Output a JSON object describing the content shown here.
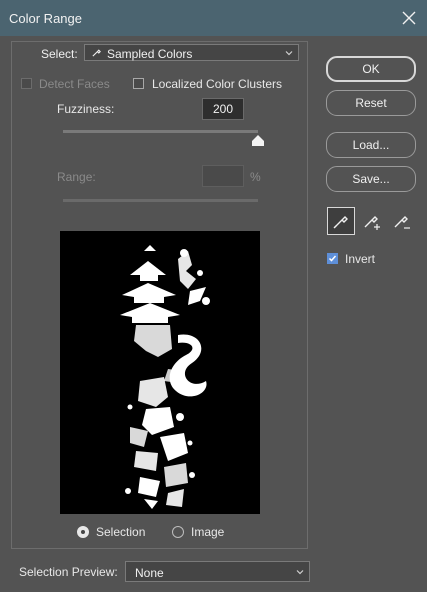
{
  "window": {
    "title": "Color Range"
  },
  "select": {
    "label": "Select:",
    "value": "Sampled Colors"
  },
  "options": {
    "detect_faces": "Detect Faces",
    "localized_color_clusters": "Localized Color Clusters"
  },
  "fuzziness": {
    "label": "Fuzziness:",
    "value": "200",
    "level": 1.0
  },
  "range": {
    "label": "Range:",
    "value": "",
    "unit": "%"
  },
  "view": {
    "selection": "Selection",
    "image": "Image",
    "selected": "Selection"
  },
  "buttons": {
    "ok": "OK",
    "reset": "Reset",
    "load": "Load...",
    "save": "Save..."
  },
  "invert": {
    "label": "Invert",
    "checked": true
  },
  "selection_preview": {
    "label": "Selection Preview:",
    "value": "None"
  },
  "tools": [
    "eyedropper-icon",
    "eyedropper-add-icon",
    "eyedropper-subtract-icon"
  ],
  "colors": {
    "titlebar": "#4b6470",
    "background": "#535353",
    "accent": "#5e8fd8"
  }
}
